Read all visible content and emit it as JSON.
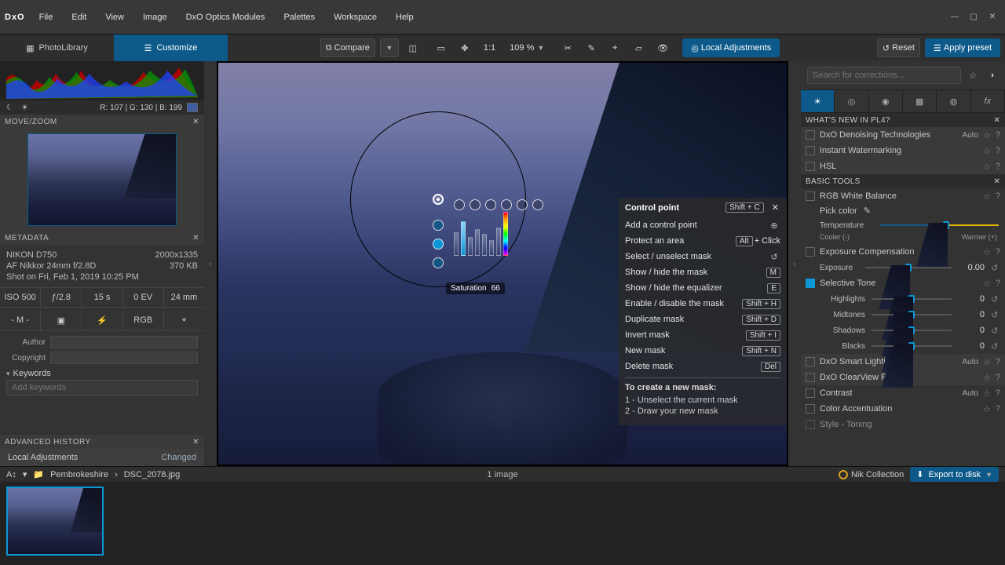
{
  "app": {
    "name": "DxO"
  },
  "menu": [
    "File",
    "Edit",
    "View",
    "Image",
    "DxO Optics Modules",
    "Palettes",
    "Workspace",
    "Help"
  ],
  "modes": {
    "library": "PhotoLibrary",
    "customize": "Customize"
  },
  "toolbar": {
    "compare": "Compare",
    "zoom_pct": "109 %",
    "one_to_one": "1:1",
    "local_adj": "Local Adjustments",
    "reset": "Reset",
    "apply_preset": "Apply preset"
  },
  "histogram": {
    "readout": "R: 107 | G: 130 | B: 199"
  },
  "panels": {
    "move_zoom": "MOVE/ZOOM",
    "metadata": "METADATA",
    "adv_history": "ADVANCED HISTORY"
  },
  "metadata": {
    "camera": "NIKON D750",
    "dims": "2000x1335",
    "lens": "AF Nikkor 24mm f/2.8D",
    "size": "370 KB",
    "date": "Shot on Fri, Feb 1, 2019 10:25 PM",
    "row": {
      "iso": "ISO 500",
      "f": "ƒ/2.8",
      "t": "15 s",
      "ev": "0 EV",
      "fl": "24 mm"
    },
    "row2": {
      "m": "- M -",
      "af": "",
      "flash": "",
      "cs": "RGB",
      "gps": ""
    },
    "author_lbl": "Author",
    "copyright_lbl": "Copyright",
    "keywords_lbl": "Keywords",
    "keywords_ph": "Add keywords"
  },
  "history": {
    "item": "Local Adjustments",
    "status": "Changed"
  },
  "control_point": {
    "title": "Control point",
    "shortcut": "Shift + C",
    "readout_label": "Saturation",
    "readout_value": "66",
    "items": [
      {
        "label": "Add a control point",
        "icon": "⊕"
      },
      {
        "label": "Protect an area",
        "kbd": "Alt",
        "suffix": " + Click"
      },
      {
        "label": "Select / unselect mask",
        "icon": "↺"
      },
      {
        "label": "Show / hide the mask",
        "kbd": "M"
      },
      {
        "label": "Show / hide the equalizer",
        "kbd": "E"
      },
      {
        "label": "Enable / disable the mask",
        "kbd": "Shift + H"
      },
      {
        "label": "Duplicate mask",
        "kbd": "Shift + D"
      },
      {
        "label": "Invert mask",
        "kbd": "Shift + I"
      },
      {
        "label": "New mask",
        "kbd": "Shift + N"
      },
      {
        "label": "Delete mask",
        "kbd": "Del"
      }
    ],
    "note_title": "To create a new mask:",
    "note1": "1 - Unselect the current mask",
    "note2": "2 - Draw your new mask"
  },
  "right": {
    "search_ph": "Search for corrections...",
    "whats_new": "WHAT'S NEW IN PL4?",
    "basic_tools": "BASIC TOOLS",
    "items_new": [
      {
        "label": "DxO Denoising Technologies",
        "auto": "Auto"
      },
      {
        "label": "Instant Watermarking"
      },
      {
        "label": "HSL"
      }
    ],
    "wb": {
      "label": "RGB White Balance",
      "pick": "Pick color",
      "temp": "Temperature",
      "cool": "Cooler (-)",
      "warm": "Warmer (+)"
    },
    "exposure_comp": "Exposure Compensation",
    "exposure": {
      "label": "Exposure",
      "value": "0.00"
    },
    "selective_tone": "Selective Tone",
    "sliders": [
      {
        "label": "Highlights",
        "value": "0"
      },
      {
        "label": "Midtones",
        "value": "0"
      },
      {
        "label": "Shadows",
        "value": "0"
      },
      {
        "label": "Blacks",
        "value": "0"
      }
    ],
    "smart_lighting": {
      "label": "DxO Smart Lighting",
      "auto": "Auto"
    },
    "clearview": {
      "label": "DxO ClearView Plus"
    },
    "contrast": {
      "label": "Contrast",
      "auto": "Auto"
    },
    "color_acc": {
      "label": "Color Accentuation"
    },
    "style_toning": {
      "label": "Style - Toning"
    }
  },
  "crumb": {
    "folder_icon": "📁",
    "folder": "Pembrokeshire",
    "file": "DSC_2078.jpg",
    "count": "1 image",
    "nik": "Nik Collection",
    "export": "Export to disk"
  }
}
